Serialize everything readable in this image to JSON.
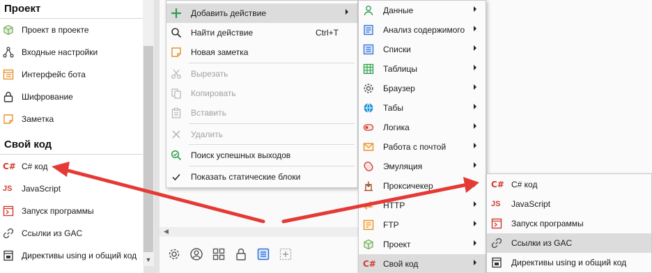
{
  "left_panel": {
    "section1_title": "Проект",
    "section1_items": [
      {
        "label": "Проект в проекте",
        "icon": "cube-icon"
      },
      {
        "label": "Входные настройки",
        "icon": "tree-nodes-icon"
      },
      {
        "label": "Интерфейс бота",
        "icon": "interface-icon"
      },
      {
        "label": "Шифрование",
        "icon": "lock-icon"
      },
      {
        "label": "Заметка",
        "icon": "note-icon"
      }
    ],
    "section2_title": "Свой код",
    "section2_items": [
      {
        "label": "C# код",
        "icon": "csharp-icon"
      },
      {
        "label": "JavaScript",
        "icon": "javascript-icon"
      },
      {
        "label": "Запуск программы",
        "icon": "run-program-icon"
      },
      {
        "label": "Ссылки из GAC",
        "icon": "link-icon"
      },
      {
        "label": "Директивы using и общий код",
        "icon": "directives-icon"
      }
    ]
  },
  "context_menu": {
    "items": [
      {
        "label": "Добавить действие",
        "shortcut": "",
        "icon": "plus-icon",
        "enabled": true,
        "submenu": true
      },
      {
        "label": "Найти действие",
        "shortcut": "Ctrl+T",
        "icon": "search-icon",
        "enabled": true
      },
      {
        "label": "Новая заметка",
        "shortcut": "",
        "icon": "note-icon",
        "enabled": true
      },
      {
        "label": "Вырезать",
        "shortcut": "",
        "icon": "scissors-icon",
        "enabled": false
      },
      {
        "label": "Копировать",
        "shortcut": "",
        "icon": "copy-icon",
        "enabled": false
      },
      {
        "label": "Вставить",
        "shortcut": "",
        "icon": "paste-icon",
        "enabled": false
      },
      {
        "label": "Удалить",
        "shortcut": "",
        "icon": "delete-icon",
        "enabled": false
      },
      {
        "label": "Поиск успешных выходов",
        "shortcut": "",
        "icon": "search-success-icon",
        "enabled": true
      },
      {
        "label": "Показать статические блоки",
        "shortcut": "",
        "icon": "checkmark-icon",
        "enabled": true
      }
    ]
  },
  "actions_menu": {
    "items": [
      {
        "label": "Данные",
        "icon": "user-icon"
      },
      {
        "label": "Анализ содержимого",
        "icon": "analysis-icon"
      },
      {
        "label": "Списки",
        "icon": "list-icon"
      },
      {
        "label": "Таблицы",
        "icon": "table-icon"
      },
      {
        "label": "Браузер",
        "icon": "gear-icon"
      },
      {
        "label": "Табы",
        "icon": "globe-icon"
      },
      {
        "label": "Логика",
        "icon": "logic-icon"
      },
      {
        "label": "Работа с почтой",
        "icon": "mail-icon"
      },
      {
        "label": "Эмуляция",
        "icon": "mouse-icon"
      },
      {
        "label": "Проксичекер",
        "icon": "proxy-icon"
      },
      {
        "label": "HTTP",
        "icon": "http-icon"
      },
      {
        "label": "FTP",
        "icon": "ftp-icon"
      },
      {
        "label": "Проект",
        "icon": "cube-icon"
      },
      {
        "label": "Свой код",
        "icon": "csharp-icon"
      }
    ]
  },
  "code_menu": {
    "items": [
      {
        "label": "C# код",
        "icon": "csharp-icon"
      },
      {
        "label": "JavaScript",
        "icon": "javascript-icon"
      },
      {
        "label": "Запуск программы",
        "icon": "run-program-icon"
      },
      {
        "label": "Ссылки из GAC",
        "icon": "link-icon"
      },
      {
        "label": "Директивы using и общий код",
        "icon": "directives-icon"
      }
    ]
  },
  "glyphs": {
    "csharp": "C#",
    "js": "JS",
    "check": "✓",
    "cross": "✕",
    "plus": "+",
    "scroll_down": "▼",
    "scroll_left": "◀"
  },
  "colors": {
    "accent_red": "#d13b2e",
    "accent_orange": "#e8912d",
    "accent_green": "#2e9e4f",
    "accent_blue": "#2f6fd6",
    "highlight": "#dcdcdc"
  }
}
